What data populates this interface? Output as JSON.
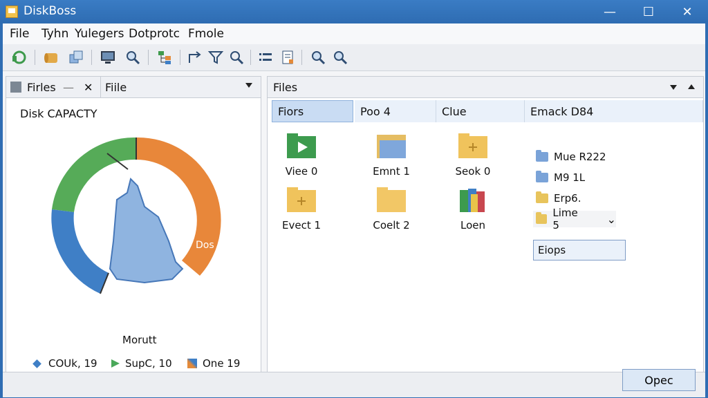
{
  "window": {
    "title": "DiskBoss",
    "minimize": "—",
    "maximize": "☐",
    "close": "✕"
  },
  "menu": [
    "File",
    "Tyhn",
    "Yulegers",
    "Dotprotc",
    "Fmole"
  ],
  "left_pane": {
    "tab_label": "Firles",
    "tab_sep": "—",
    "tab_close": "✕",
    "dropdown_label": "Fiile",
    "heading": "Disk CAPACTY",
    "chart_label_right": "Dos",
    "chart_label_bottom": "Morutt",
    "legend": [
      {
        "label": "COUk, 19",
        "color": "#3f7fc6",
        "icon": "diamond-icon"
      },
      {
        "label": "SupC, 10",
        "color": "#4aa85a",
        "icon": "flag-icon"
      },
      {
        "label": "One 19",
        "color": "#e38a3a",
        "icon": "pencil-icon"
      }
    ]
  },
  "right_pane": {
    "tab_label": "Files",
    "columns": [
      "Fiors",
      "Poo 4",
      "Clue",
      "Emack D84"
    ],
    "grid_items": [
      {
        "label": "Viee 0",
        "icon": "play-folder-icon"
      },
      {
        "label": "Emnt 1",
        "icon": "folder-icon"
      },
      {
        "label": "Seok 0",
        "icon": "add-folder-icon"
      },
      {
        "label": "Evect 1",
        "icon": "add-folder-icon"
      },
      {
        "label": "Coelt 2",
        "icon": "folder-icon"
      },
      {
        "label": "Loen",
        "icon": "books-icon"
      }
    ],
    "list_items": [
      {
        "label": "Mue R222",
        "icon": "folder-icon"
      },
      {
        "label": "M9 1L",
        "icon": "network-folder-icon"
      },
      {
        "label": "Erp6.",
        "icon": "folder-icon"
      },
      {
        "label": "Lime 5",
        "icon": "folder-icon"
      }
    ],
    "chevron": "⌄",
    "search_value": "Eiops"
  },
  "footer": {
    "open_button": "Opec"
  },
  "colors": {
    "title_bar": "#2e6cb2",
    "accent": "#c9dcf3",
    "green": "#4aa85a",
    "orange": "#e38a3a",
    "blue": "#3f7fc6"
  }
}
